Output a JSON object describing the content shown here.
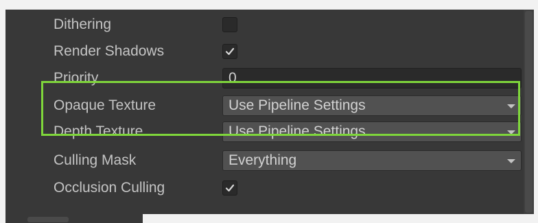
{
  "properties": [
    {
      "label": "Dithering",
      "type": "checkbox",
      "checked": false
    },
    {
      "label": "Render Shadows",
      "type": "checkbox",
      "checked": true
    },
    {
      "label": "Priority",
      "type": "number",
      "value": "0"
    },
    {
      "label": "Opaque Texture",
      "type": "dropdown",
      "value": "Use Pipeline Settings",
      "highlighted": true
    },
    {
      "label": "Depth Texture",
      "type": "dropdown",
      "value": "Use Pipeline Settings",
      "highlighted": true
    },
    {
      "label": "Culling Mask",
      "type": "dropdown",
      "value": "Everything"
    },
    {
      "label": "Occlusion Culling",
      "type": "checkbox",
      "checked": true
    }
  ],
  "colors": {
    "panel_bg": "#383838",
    "highlight_border": "#7fd63b",
    "label_text": "#c4c4c4"
  },
  "icons": {
    "checkmark": "checkmark-icon",
    "dropdown_arrow": "dropdown-arrow-icon"
  }
}
